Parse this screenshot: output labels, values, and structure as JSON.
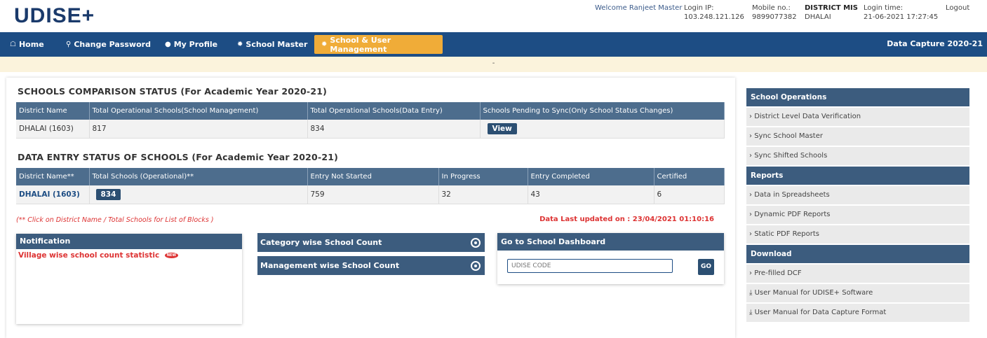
{
  "header": {
    "logo": "UDISE+",
    "welcome": "Welcome Ranjeet Master",
    "login_ip_label": "Login IP:",
    "login_ip": "103.248.121.126",
    "mobile_label": "Mobile no.:",
    "mobile": "9899077382",
    "role_label": "DISTRICT MIS",
    "role_value": "DHALAI",
    "login_time_label": "Login time:",
    "login_time": "21-06-2021 17:27:45",
    "logout": "Logout"
  },
  "nav": {
    "home": "Home",
    "change_password": "Change Password",
    "my_profile": "My Profile",
    "school_master": "School Master",
    "school_user_mgmt": "School & User Management",
    "data_capture": "Data Capture 2020-21"
  },
  "alert": "-",
  "comparison": {
    "title": "SCHOOLS COMPARISON STATUS (For Academic Year 2020-21)",
    "headers": [
      "District Name",
      "Total Operational Schools(School Management)",
      "Total Operational Schools(Data Entry)",
      "Schools Pending to Sync(Only School Status Changes)"
    ],
    "row": {
      "district": "DHALAI (1603)",
      "mgmt": "817",
      "entry": "834",
      "view": "View"
    }
  },
  "entry_status": {
    "title": "DATA ENTRY STATUS OF SCHOOLS (For Academic Year 2020-21)",
    "headers": [
      "District Name**",
      "Total Schools (Operational)**",
      "Entry Not Started",
      "In Progress",
      "Entry Completed",
      "Certified"
    ],
    "row": {
      "district": "DHALAI (1603)",
      "total": "834",
      "not_started": "759",
      "in_progress": "32",
      "completed": "43",
      "certified": "6"
    }
  },
  "note": "(** Click on District Name / Total Schools for List of Blocks )",
  "updated": "Data Last updated on : 23/04/2021 01:10:16",
  "notification": {
    "title": "Notification",
    "item": "Village wise school count statistic",
    "badge": "NEW"
  },
  "bars": {
    "category": "Category wise School Count",
    "management": "Management wise School Count"
  },
  "dashboard": {
    "title": "Go to School Dashboard",
    "placeholder": "UDISE CODE",
    "go": "GO"
  },
  "sidebar": {
    "ops_title": "School Operations",
    "ops": [
      "District Level Data Verification",
      "Sync School Master",
      "Sync Shifted Schools"
    ],
    "reports_title": "Reports",
    "reports": [
      "Data in Spreadsheets",
      "Dynamic PDF Reports",
      "Static PDF Reports"
    ],
    "download_title": "Download",
    "downloads": [
      "Pre-filled DCF",
      "User Manual for UDISE+ Software",
      "User Manual for Data Capture Format"
    ]
  },
  "colors": {
    "nav": "#1d4d84",
    "accent": "#f0ac38",
    "table_head": "#4d6d8d",
    "alert": "#d33333"
  }
}
